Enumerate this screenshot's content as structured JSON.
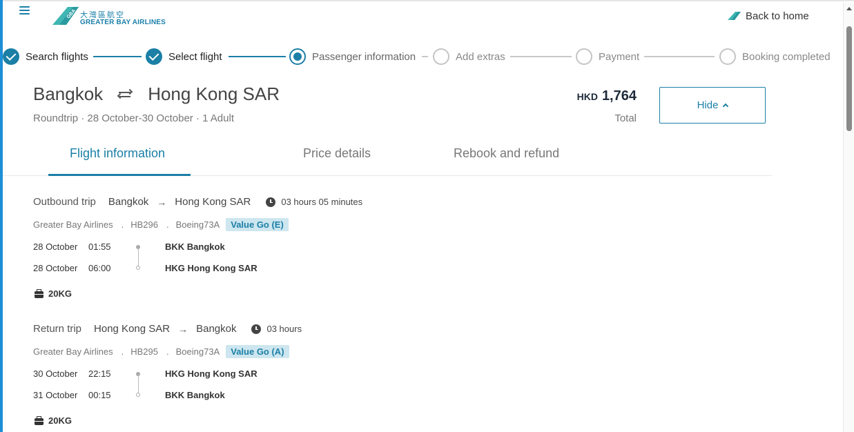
{
  "header": {
    "logo_cn": "大灣區航空",
    "logo_en": "GREATER BAY AIRLINES",
    "back_home_label": "Back to home"
  },
  "stepper": {
    "steps": [
      {
        "label": "Search flights",
        "state": "done"
      },
      {
        "label": "Select flight",
        "state": "done"
      },
      {
        "label": "Passenger information",
        "state": "current"
      },
      {
        "label": "Add extras",
        "state": "todo"
      },
      {
        "label": "Payment",
        "state": "todo"
      },
      {
        "label": "Booking completed",
        "state": "todo"
      }
    ]
  },
  "summary": {
    "origin": "Bangkok",
    "destination": "Hong Kong SAR",
    "meta": "Roundtrip · 28 October-30 October · 1 Adult",
    "currency": "HKD",
    "amount": "1,764",
    "total_label": "Total",
    "hide_label": "Hide"
  },
  "tabs": [
    {
      "label": "Flight information",
      "active": true
    },
    {
      "label": "Price details",
      "active": false
    },
    {
      "label": "Rebook and refund",
      "active": false
    }
  ],
  "trips": [
    {
      "kind": "Outbound trip",
      "from": "Bangkok",
      "to": "Hong Kong SAR",
      "duration": "03 hours 05 minutes",
      "airline": "Greater Bay Airlines",
      "flight_no": "HB296",
      "aircraft": "Boeing73A",
      "fare": "Value Go (E)",
      "dep_date": "28 October",
      "dep_time": "01:55",
      "dep_code": "BKK",
      "dep_city": "Bangkok",
      "arr_date": "28 October",
      "arr_time": "06:00",
      "arr_code": "HKG",
      "arr_city": "Hong Kong SAR",
      "baggage": "20KG"
    },
    {
      "kind": "Return trip",
      "from": "Hong Kong SAR",
      "to": "Bangkok",
      "duration": "03 hours",
      "airline": "Greater Bay Airlines",
      "flight_no": "HB295",
      "aircraft": "Boeing73A",
      "fare": "Value Go (A)",
      "dep_date": "30 October",
      "dep_time": "22:15",
      "dep_code": "HKG",
      "dep_city": "Hong Kong SAR",
      "arr_date": "31 October",
      "arr_time": "00:15",
      "arr_code": "BKK",
      "arr_city": "Bangkok",
      "baggage": "20KG"
    }
  ],
  "colors": {
    "brand": "#1b7fa6",
    "badge_bg": "#cde6ef",
    "inactive_step": "#c8c8c8"
  }
}
